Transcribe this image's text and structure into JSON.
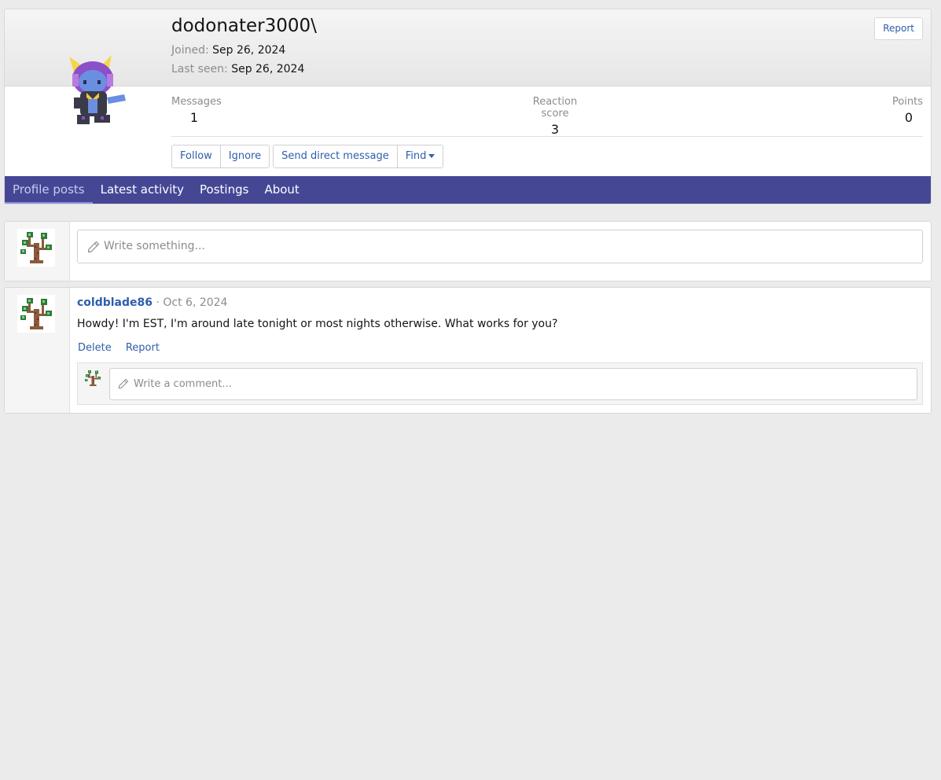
{
  "profile": {
    "username": "dodonater3000\\",
    "joined_label": "Joined:",
    "joined_value": "Sep 26, 2024",
    "last_seen_label": "Last seen:",
    "last_seen_value": "Sep 26, 2024",
    "report_label": "Report",
    "avatar_icon": "creature-sprite-avatar"
  },
  "stats": {
    "messages_label": "Messages",
    "messages_value": "1",
    "reaction_label": "Reaction score",
    "reaction_value": "3",
    "points_label": "Points",
    "points_value": "0"
  },
  "actions": {
    "follow": "Follow",
    "ignore": "Ignore",
    "send_dm": "Send direct message",
    "find": "Find"
  },
  "tabs": [
    {
      "label": "Profile posts",
      "active": true
    },
    {
      "label": "Latest activity",
      "active": false
    },
    {
      "label": "Postings",
      "active": false
    },
    {
      "label": "About",
      "active": false
    }
  ],
  "composer": {
    "placeholder": "Write something...",
    "avatar_icon": "tree-sprite-avatar"
  },
  "post": {
    "author": "coldblade86",
    "separator": "·",
    "date": "Oct 6, 2024",
    "body": "Howdy! I'm EST, I'm around late tonight or most nights otherwise. What works for you?",
    "delete_label": "Delete",
    "report_label": "Report",
    "comment_placeholder": "Write a comment..."
  },
  "colors": {
    "accent": "#454795",
    "link": "#2e5dad",
    "page_bg": "#ebebeb"
  }
}
